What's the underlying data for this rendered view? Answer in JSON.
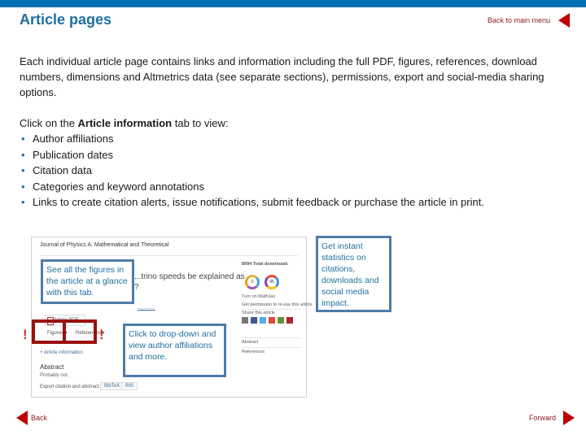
{
  "header": {
    "title": "Article pages",
    "back_to_main_label": "Back to main menu",
    "accent_color": "#0070b0",
    "nav_color": "#c00000"
  },
  "intro": "Each individual article page contains links and information including the full PDF, figures, references, download numbers, dimensions and Altmetrics data (see separate sections), permissions, export and social-media sharing options.",
  "lead": {
    "prefix": "Click on the ",
    "bold": "Article information",
    "suffix": " tab to view:"
  },
  "bullets": [
    "Author affiliations",
    "Publication dates",
    "Citation data",
    "Categories and keyword annotations",
    "Links to create citation alerts, issue notifications, submit feedback or purchase the article in print."
  ],
  "screenshot": {
    "journal": "Journal of Physics A: Mathematical and Theoretical",
    "article_title_line1": "...trino speeds be explained as",
    "article_title_line2": "?",
    "authors": "..., ........",
    "pdf_button": "Article PDF",
    "tabs": [
      "Figures ▾",
      "References ▾"
    ],
    "article_information": "+ Article information",
    "abstract_heading": "Abstract",
    "abstract_text": "Probably not.",
    "export_label": "Export citation and abstract",
    "export_buttons": [
      "BibTeX",
      "RIS"
    ],
    "downloads": "8994 Total downloads",
    "badge1": "0",
    "badge2": "95",
    "turn_on_mathjax": "Turn on MathJax",
    "permission": "Get permission to re-use this article",
    "share": "Share this article",
    "menu": [
      "Abstract",
      "References"
    ]
  },
  "callouts": {
    "figures": "See all the figures in the article at a glance with this tab.",
    "stats": "Get instant statistics on citations, downloads and social media impact.",
    "dropdown": "Click to drop-down and view author affiliations and more."
  },
  "exclamation": "!",
  "footer": {
    "back_label": "Back",
    "forward_label": "Forward"
  }
}
